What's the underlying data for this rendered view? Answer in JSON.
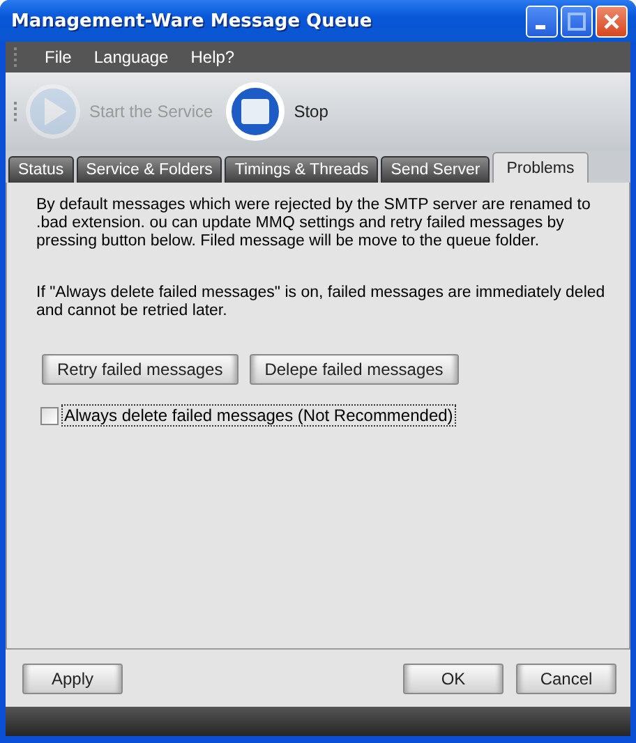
{
  "window": {
    "title": "Management-Ware Message Queue"
  },
  "menu": [
    "File",
    "Language",
    "Help?"
  ],
  "toolbar": [
    {
      "kind": "start",
      "label": "Start the Service",
      "disabled": true
    },
    {
      "kind": "stop",
      "label": "Stop",
      "disabled": false
    }
  ],
  "tabs": [
    {
      "label": "Status",
      "selected": false
    },
    {
      "label": "Service & Folders",
      "selected": false
    },
    {
      "label": "Timings & Threads",
      "selected": false
    },
    {
      "label": "Send Server",
      "selected": false
    },
    {
      "label": "Problems",
      "selected": true
    }
  ],
  "paragraphs": [
    "By default messages which were rejected by the SMTP server are renamed to .bad extension. ou can update MMQ settings and retry failed messages by pressing button below. Filed message will be move to the queue folder.",
    "If \"Always delete failed messages\" is on, failed messages are immediately deled and cannot be retried later."
  ],
  "actions": [
    "Retry failed messages",
    "Delepe failed messages"
  ],
  "checkbox": {
    "label": "Always delete failed messages (Not Recommended)",
    "checked": false,
    "focused": true
  },
  "footer": {
    "left": [
      "Apply"
    ],
    "right": [
      "OK",
      "Cancel"
    ]
  }
}
